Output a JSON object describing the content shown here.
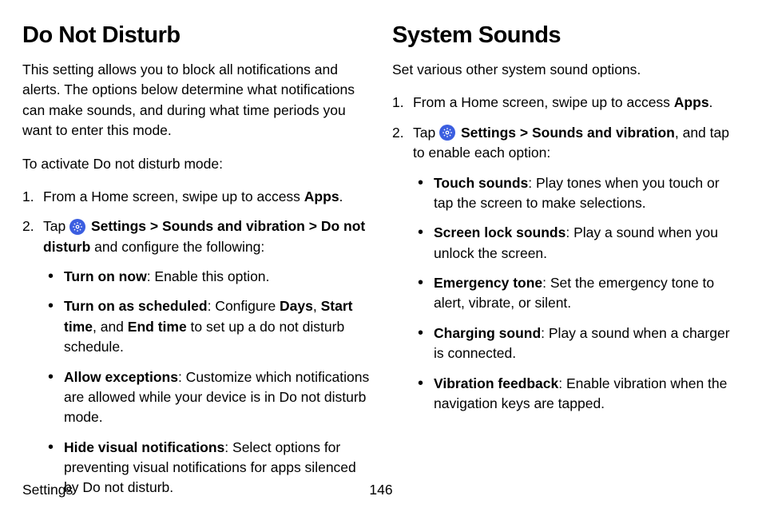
{
  "left": {
    "heading": "Do Not Disturb",
    "intro": "This setting allows you to block all notifications and alerts. The options below determine what notifications can make sounds, and during what time periods you want to enter this mode.",
    "activate_label": "To activate Do not disturb mode:",
    "step1_prefix": "From a Home screen, swipe up to access ",
    "step1_bold": "Apps",
    "step1_suffix": ".",
    "step2_tap": "Tap ",
    "step2_settings": "Settings",
    "step2_sep1": " > ",
    "step2_sounds": "Sounds and vibration",
    "step2_sep2": " > ",
    "step2_dnd": "Do not disturb",
    "step2_suffix": " and configure the following:",
    "bullets": {
      "b1_bold": "Turn on now",
      "b1_rest": ": Enable this option.",
      "b2_bold": "Turn on as scheduled",
      "b2_pre": ": Configure ",
      "b2_days": "Days",
      "b2_c1": ", ",
      "b2_start": "Start time",
      "b2_c2": ", and ",
      "b2_end": "End time",
      "b2_rest": " to set up a do not disturb schedule.",
      "b3_bold": "Allow exceptions",
      "b3_rest": ": Customize which notifications are allowed while your device is in Do not disturb mode.",
      "b4_bold": "Hide visual notifications",
      "b4_rest": ": Select options for preventing visual notifications for apps silenced by Do not disturb."
    }
  },
  "right": {
    "heading": "System Sounds",
    "intro": "Set various other system sound options.",
    "step1_prefix": "From a Home screen, swipe up to access ",
    "step1_bold": "Apps",
    "step1_suffix": ".",
    "step2_tap": "Tap ",
    "step2_settings": "Settings",
    "step2_sep1": " > ",
    "step2_sounds": "Sounds and vibration",
    "step2_suffix": ", and tap to enable each option:",
    "bullets": {
      "b1_bold": "Touch sounds",
      "b1_rest": ": Play tones when you touch or tap the screen to make selections.",
      "b2_bold": "Screen lock sounds",
      "b2_rest": ": Play a sound when you unlock the screen.",
      "b3_bold": "Emergency tone",
      "b3_rest": ": Set the emergency tone to alert, vibrate, or silent.",
      "b4_bold": "Charging sound",
      "b4_rest": ": Play a sound when a charger is connected.",
      "b5_bold": "Vibration feedback",
      "b5_rest": ": Enable vibration when the navigation keys are tapped."
    }
  },
  "footer": {
    "section": "Settings",
    "page": "146"
  }
}
